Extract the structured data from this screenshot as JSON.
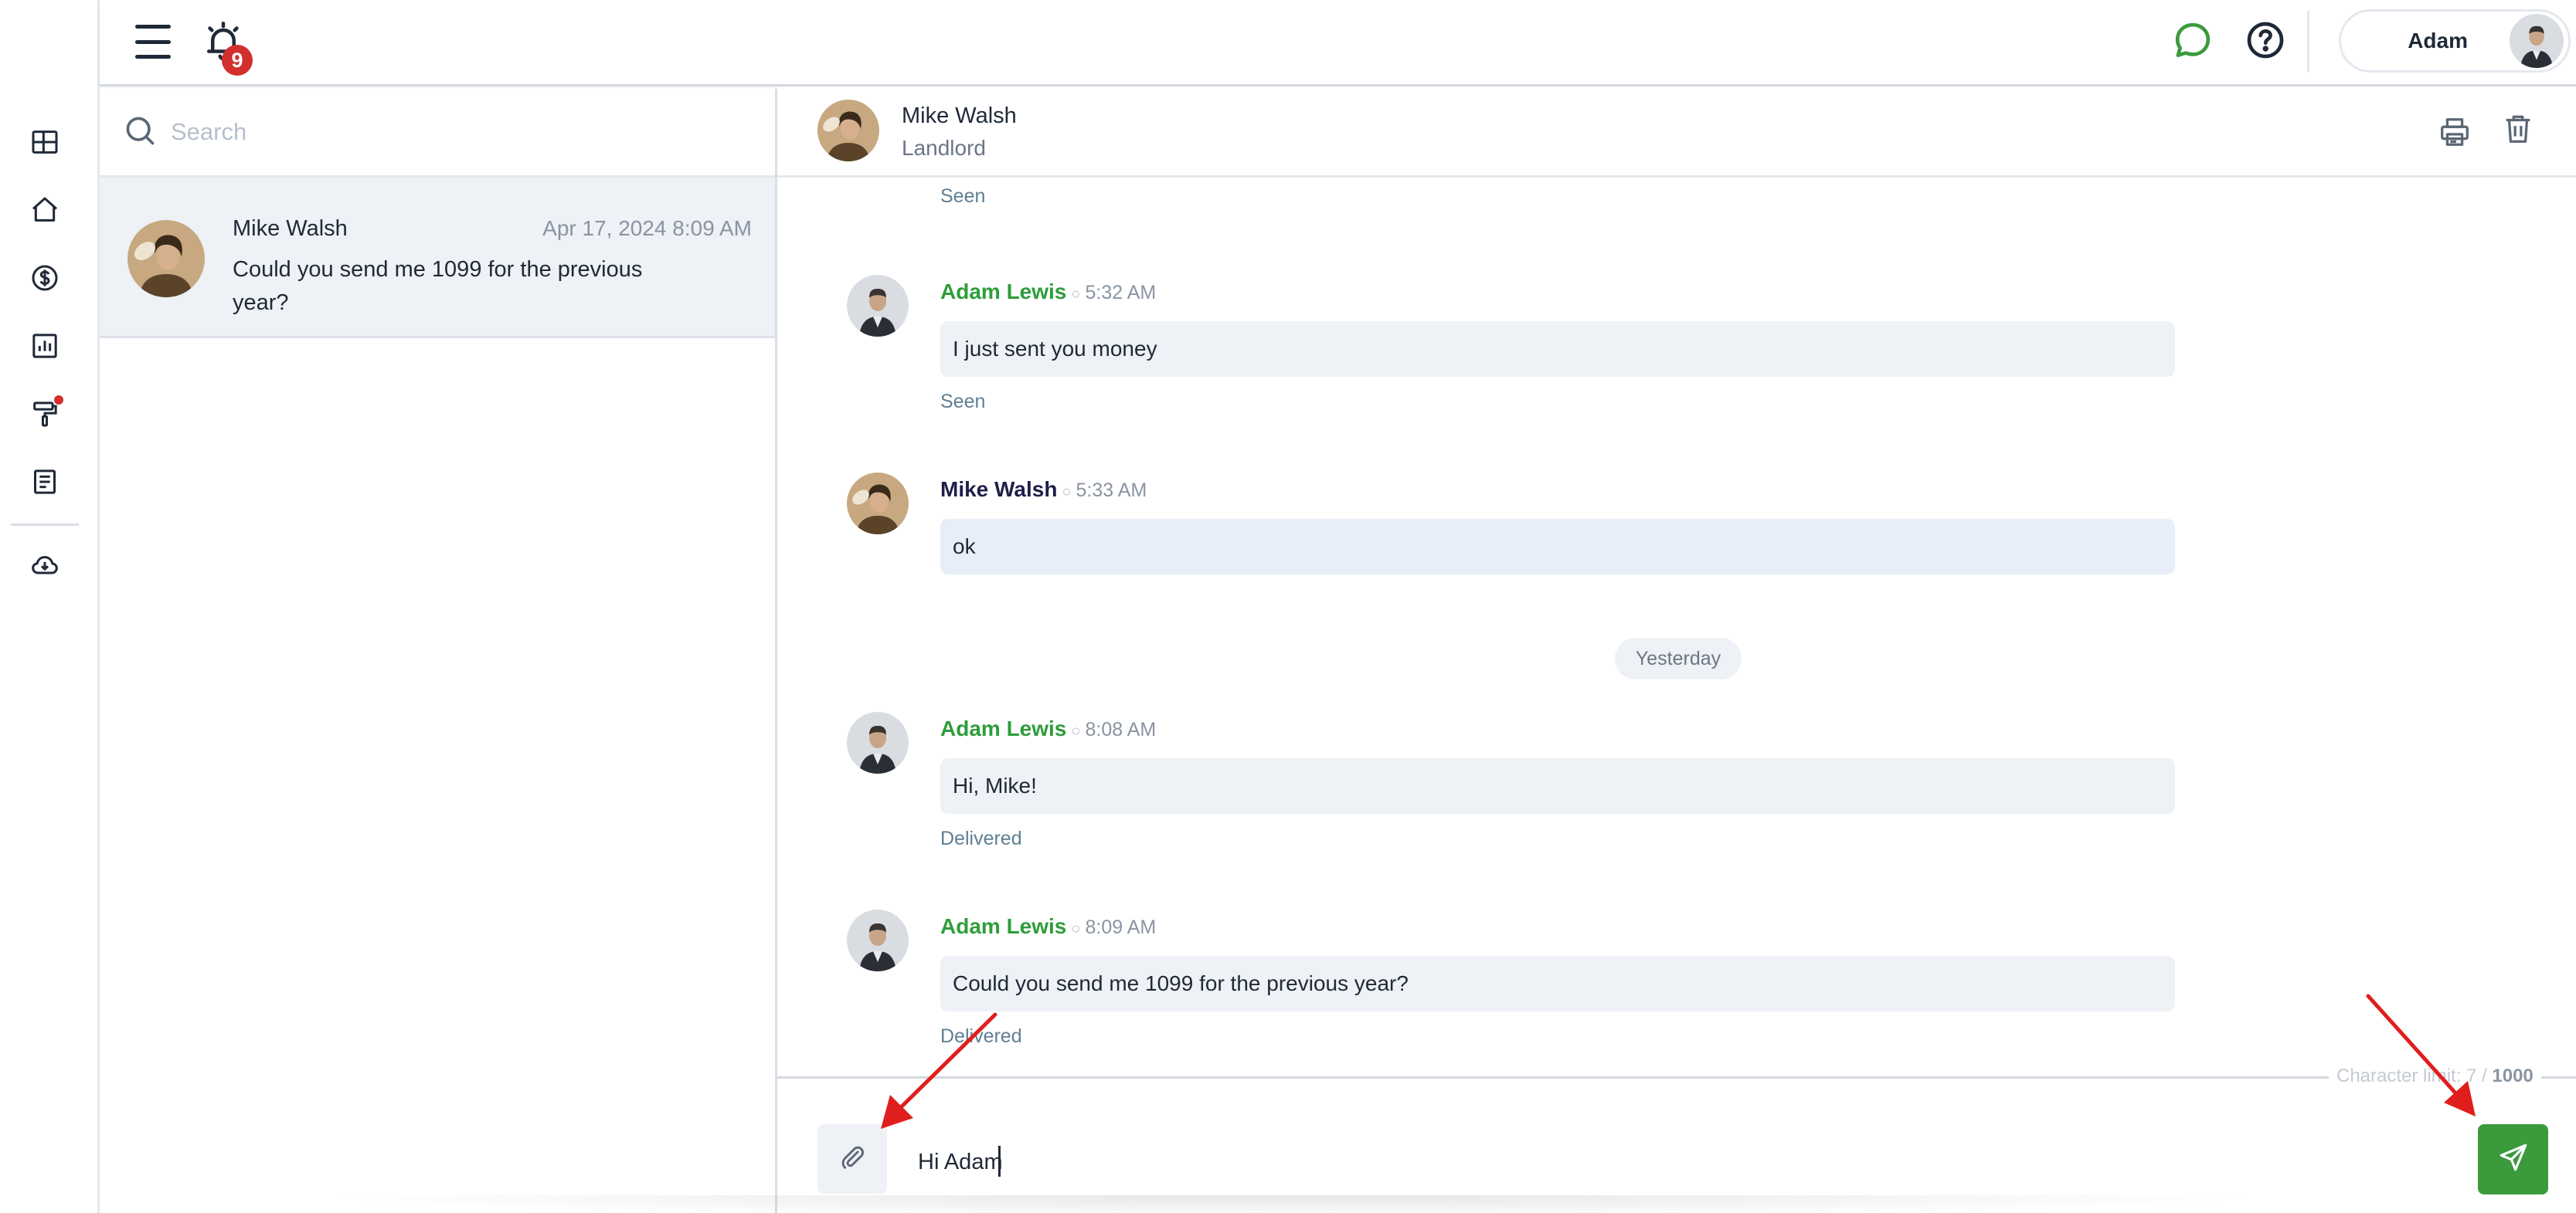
{
  "colors": {
    "accent_green": "#3a9a3c",
    "sender_me": "#2e9d3a",
    "sender_them": "#1f1f4a",
    "badge_red": "#d32f2f",
    "annotation_arrow": "#e01e1e"
  },
  "sidebar": {
    "items": [
      {
        "icon": "dashboard-grid-icon"
      },
      {
        "icon": "home-icon"
      },
      {
        "icon": "dollar-circle-icon"
      },
      {
        "icon": "bar-chart-icon"
      },
      {
        "icon": "paint-roller-icon",
        "has_dot": true
      },
      {
        "icon": "document-icon"
      },
      {
        "icon": "cloud-download-icon"
      }
    ]
  },
  "topbar": {
    "menu_icon": "hamburger-menu-icon",
    "notifications": {
      "icon": "alarm-bell-icon",
      "count": "9"
    },
    "chat_icon": "chat-bubble-icon",
    "help_icon": "help-circle-icon",
    "user": {
      "name": "Adam"
    }
  },
  "conversation_list": {
    "search": {
      "placeholder": "Search",
      "value": ""
    },
    "items": [
      {
        "name": "Mike Walsh",
        "timestamp": "Apr 17, 2024 8:09 AM",
        "preview": "Could you send me 1099 for the previous year?"
      }
    ]
  },
  "chat": {
    "header": {
      "name": "Mike Walsh",
      "role": "Landlord"
    },
    "top_status": "Seen",
    "messages": [
      {
        "sender": "Adam Lewis",
        "time": "5:32 AM",
        "text": "I just sent you money",
        "status": "Seen",
        "mine": true
      },
      {
        "sender": "Mike Walsh",
        "time": "5:33 AM",
        "text": "ok",
        "status": "",
        "mine": false
      },
      {
        "sender": "Adam Lewis",
        "time": "8:08 AM",
        "text": "Hi, Mike!",
        "status": "Delivered",
        "mine": true
      },
      {
        "sender": "Adam Lewis",
        "time": "8:09 AM",
        "text": "Could you send me 1099 for the previous year?",
        "status": "Delivered",
        "mine": true
      }
    ],
    "date_divider": "Yesterday",
    "composer": {
      "value": "Hi Adam",
      "char_limit_label": "Character limit: 7 /",
      "char_limit_max": "1000"
    }
  }
}
